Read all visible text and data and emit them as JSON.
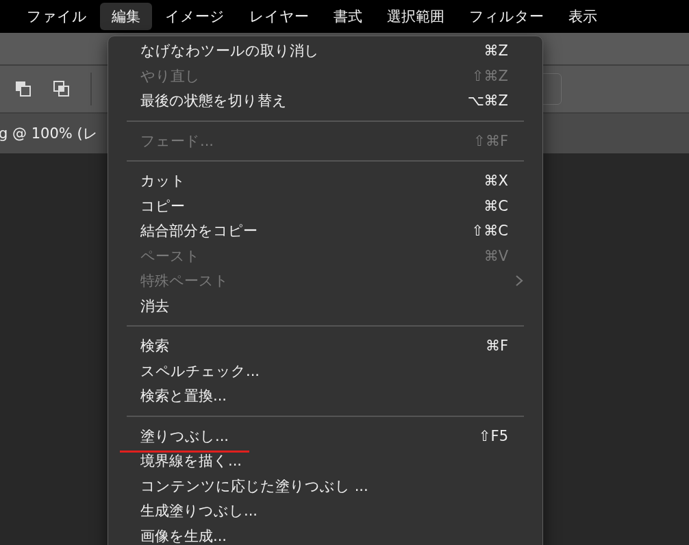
{
  "menubar": [
    {
      "label": "ファイル",
      "selected": false
    },
    {
      "label": "編集",
      "selected": true
    },
    {
      "label": "イメージ",
      "selected": false
    },
    {
      "label": "レイヤー",
      "selected": false
    },
    {
      "label": "書式",
      "selected": false
    },
    {
      "label": "選択範囲",
      "selected": false
    },
    {
      "label": "フィルター",
      "selected": false
    },
    {
      "label": "表示",
      "selected": false
    }
  ],
  "document_tab": {
    "title": "g @ 100% (レ"
  },
  "menu": {
    "items": [
      {
        "kind": "item",
        "label": "なげなわツールの取り消し",
        "shortcut": "⌘Z",
        "disabled": false
      },
      {
        "kind": "item",
        "label": "やり直し",
        "shortcut": "⇧⌘Z",
        "disabled": true
      },
      {
        "kind": "item",
        "label": "最後の状態を切り替え",
        "shortcut": "⌥⌘Z",
        "disabled": false
      },
      {
        "kind": "separator"
      },
      {
        "kind": "item",
        "label": "フェード...",
        "shortcut": "⇧⌘F",
        "disabled": true
      },
      {
        "kind": "separator"
      },
      {
        "kind": "item",
        "label": "カット",
        "shortcut": "⌘X",
        "disabled": false
      },
      {
        "kind": "item",
        "label": "コピー",
        "shortcut": "⌘C",
        "disabled": false
      },
      {
        "kind": "item",
        "label": "結合部分をコピー",
        "shortcut": "⇧⌘C",
        "disabled": false
      },
      {
        "kind": "item",
        "label": "ペースト",
        "shortcut": "⌘V",
        "disabled": true
      },
      {
        "kind": "submenu",
        "label": "特殊ペースト",
        "disabled": true
      },
      {
        "kind": "item",
        "label": "消去",
        "disabled": false
      },
      {
        "kind": "separator"
      },
      {
        "kind": "item",
        "label": "検索",
        "shortcut": "⌘F",
        "disabled": false
      },
      {
        "kind": "item",
        "label": "スペルチェック...",
        "disabled": false
      },
      {
        "kind": "item",
        "label": "検索と置換...",
        "disabled": false
      },
      {
        "kind": "separator"
      },
      {
        "kind": "item",
        "label": "塗りつぶし...",
        "shortcut": "⇧F5",
        "disabled": false,
        "underlined": true
      },
      {
        "kind": "item",
        "label": "境界線を描く...",
        "disabled": false
      },
      {
        "kind": "item",
        "label": "コンテンツに応じた塗りつぶし ...",
        "disabled": false
      },
      {
        "kind": "item",
        "label": "生成塗りつぶし...",
        "disabled": false
      },
      {
        "kind": "item",
        "label": "画像を生成...",
        "disabled": false
      }
    ]
  }
}
